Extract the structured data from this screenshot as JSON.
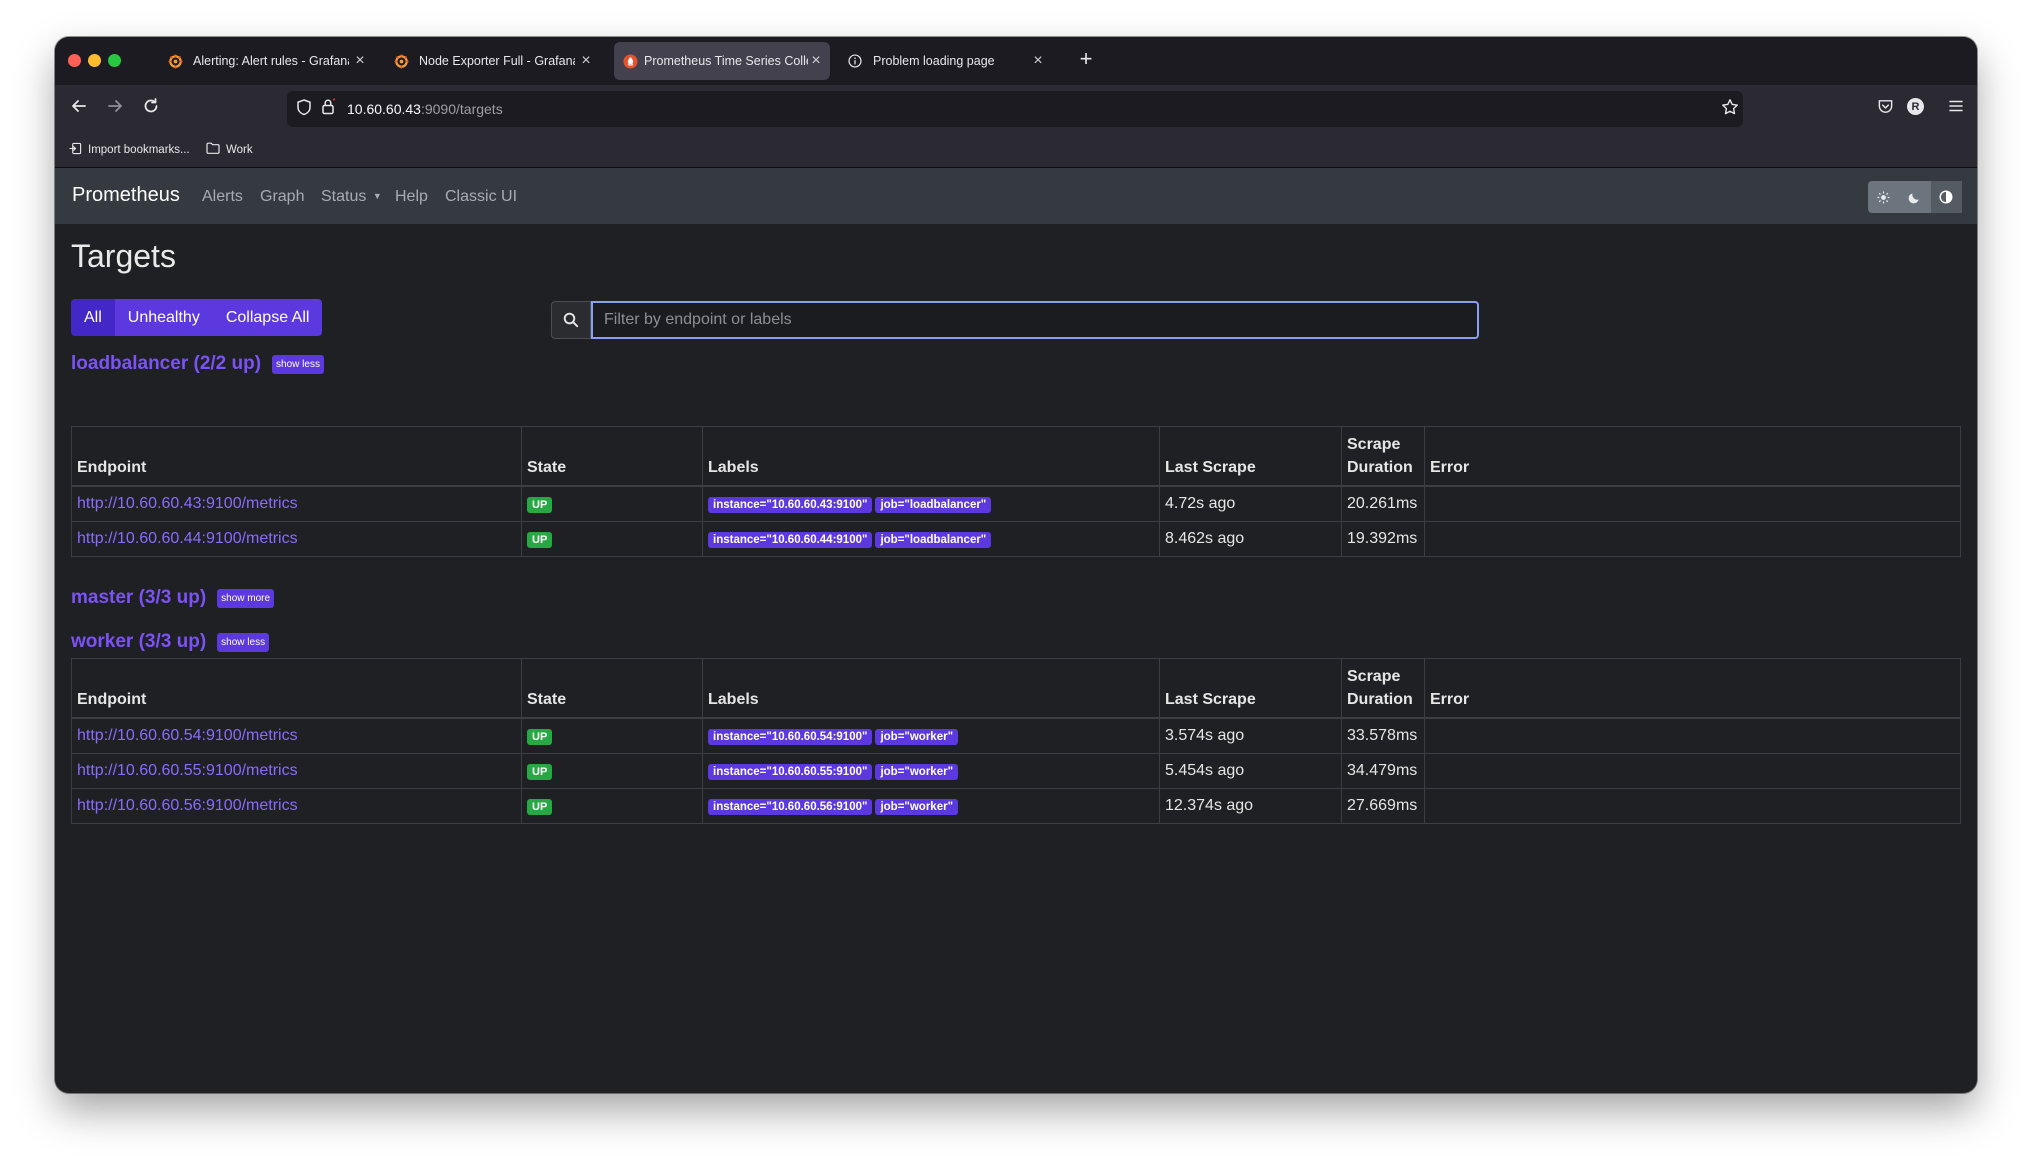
{
  "browser": {
    "tabs": [
      {
        "title": "Alerting: Alert rules - Grafana",
        "icon": "grafana-icon"
      },
      {
        "title": "Node Exporter Full - Grafana",
        "icon": "grafana-icon"
      },
      {
        "title": "Prometheus Time Series Collect",
        "icon": "prometheus-icon",
        "active": true
      },
      {
        "title": "Problem loading page",
        "icon": "info-icon"
      }
    ],
    "url_host": "10.60.60.43",
    "url_rest": ":9090/targets",
    "bookmarks": [
      "Import bookmarks...",
      "Work"
    ],
    "profile_initial": "R"
  },
  "app": {
    "brand": "Prometheus",
    "nav": [
      "Alerts",
      "Graph",
      "Status",
      "Help",
      "Classic UI"
    ]
  },
  "page": {
    "title": "Targets",
    "filters": [
      "All",
      "Unhealthy",
      "Collapse All"
    ],
    "search_placeholder": "Filter by endpoint or labels"
  },
  "columns": {
    "endpoint": "Endpoint",
    "state": "State",
    "labels": "Labels",
    "last_scrape": "Last Scrape",
    "scrape_duration_1": "Scrape",
    "scrape_duration_2": "Duration",
    "error": "Error"
  },
  "pools": [
    {
      "title": "loadbalancer (2/2 up)",
      "toggle": "show less",
      "rows": [
        {
          "endpoint": "http://10.60.60.43:9100/metrics",
          "state": "UP",
          "instance": "instance=\"10.60.60.43:9100\"",
          "job": "job=\"loadbalancer\"",
          "last_scrape": "4.72s ago",
          "duration": "20.261ms",
          "error": ""
        },
        {
          "endpoint": "http://10.60.60.44:9100/metrics",
          "state": "UP",
          "instance": "instance=\"10.60.60.44:9100\"",
          "job": "job=\"loadbalancer\"",
          "last_scrape": "8.462s ago",
          "duration": "19.392ms",
          "error": ""
        }
      ]
    },
    {
      "title": "master (3/3 up)",
      "toggle": "show more",
      "rows": []
    },
    {
      "title": "worker (3/3 up)",
      "toggle": "show less",
      "rows": [
        {
          "endpoint": "http://10.60.60.54:9100/metrics",
          "state": "UP",
          "instance": "instance=\"10.60.60.54:9100\"",
          "job": "job=\"worker\"",
          "last_scrape": "3.574s ago",
          "duration": "33.578ms",
          "error": ""
        },
        {
          "endpoint": "http://10.60.60.55:9100/metrics",
          "state": "UP",
          "instance": "instance=\"10.60.60.55:9100\"",
          "job": "job=\"worker\"",
          "last_scrape": "5.454s ago",
          "duration": "34.479ms",
          "error": ""
        },
        {
          "endpoint": "http://10.60.60.56:9100/metrics",
          "state": "UP",
          "instance": "instance=\"10.60.60.56:9100\"",
          "job": "job=\"worker\"",
          "last_scrape": "12.374s ago",
          "duration": "27.669ms",
          "error": ""
        }
      ]
    }
  ],
  "colors": {
    "accent": "#5b39df",
    "link": "#8a6bff",
    "up": "#28a745",
    "background": "#1f2023"
  }
}
